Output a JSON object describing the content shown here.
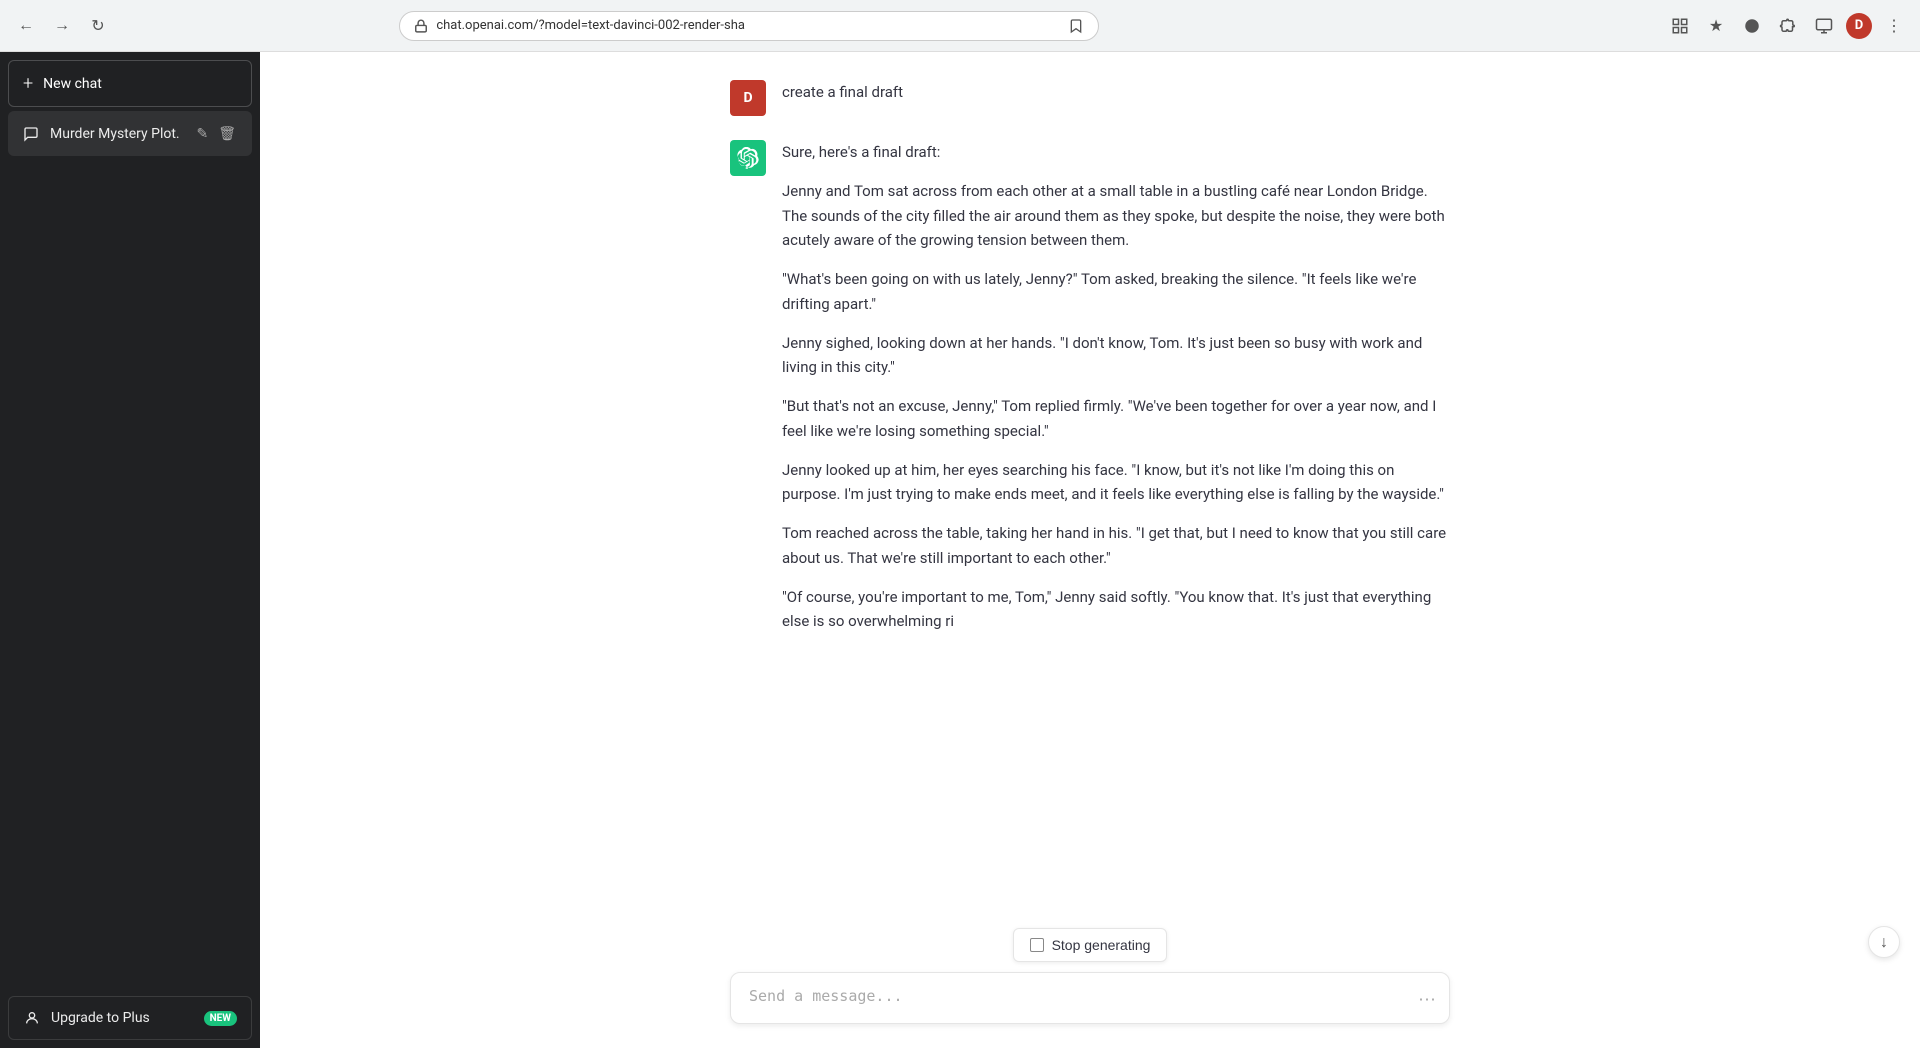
{
  "browser": {
    "url": "chat.openai.com/?model=text-davinci-002-render-sha",
    "back_label": "←",
    "forward_label": "→",
    "reload_label": "↻",
    "avatar_label": "D"
  },
  "sidebar": {
    "new_chat_label": "New chat",
    "chat_history": [
      {
        "id": "murder-mystery",
        "label": "Murder Mystery Plot.",
        "active": true
      }
    ],
    "upgrade": {
      "label": "Upgrade to Plus",
      "badge": "NEW"
    }
  },
  "chat": {
    "user_message": "create a final draft",
    "ai_response": {
      "intro": "Sure, here's a final draft:",
      "paragraphs": [
        "Jenny and Tom sat across from each other at a small table in a bustling café near London Bridge. The sounds of the city filled the air around them as they spoke, but despite the noise, they were both acutely aware of the growing tension between them.",
        "\"What's been going on with us lately, Jenny?\" Tom asked, breaking the silence. \"It feels like we're drifting apart.\"",
        "Jenny sighed, looking down at her hands. \"I don't know, Tom. It's just been so busy with work and living in this city.\"",
        "\"But that's not an excuse, Jenny,\" Tom replied firmly. \"We've been together for over a year now, and I feel like we're losing something special.\"",
        "Jenny looked up at him, her eyes searching his face. \"I know, but it's not like I'm doing this on purpose. I'm just trying to make ends meet, and it feels like everything else is falling by the wayside.\"",
        "Tom reached across the table, taking her hand in his. \"I get that, but I need to know that you still care about us. That we're still important to each other.\"",
        "\"Of course, you're important to me, Tom,\" Jenny said softly. \"You know that. It's just that everything else is so overwhelming ri"
      ]
    }
  },
  "input": {
    "placeholder": "Send a message...",
    "send_icon": "▲"
  },
  "stop_generating": {
    "label": "Stop generating"
  },
  "scroll_bottom_icon": "↓"
}
